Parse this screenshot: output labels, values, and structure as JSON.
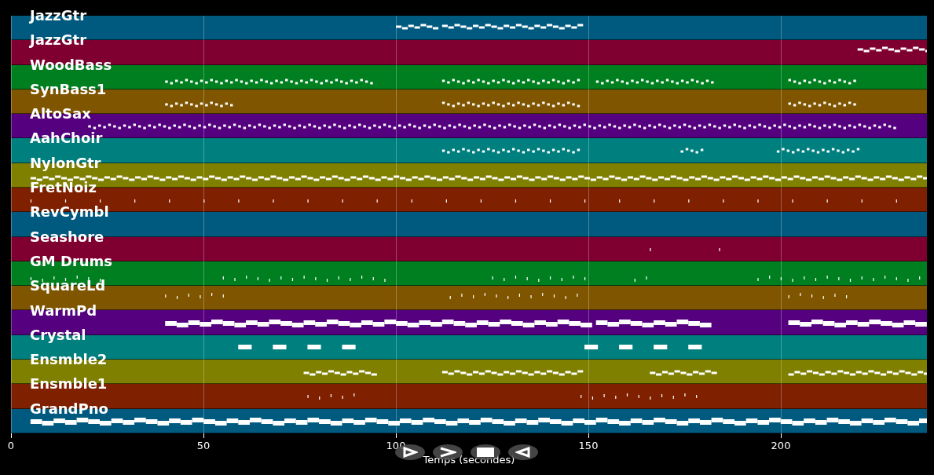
{
  "tracks": [
    {
      "name": "JazzGtr",
      "color": "#005a7f"
    },
    {
      "name": "JazzGtr",
      "color": "#7f0030"
    },
    {
      "name": "WoodBass",
      "color": "#007f20"
    },
    {
      "name": "SynBass1",
      "color": "#7f5500"
    },
    {
      "name": "AltoSax",
      "color": "#55007f"
    },
    {
      "name": "AahChoir",
      "color": "#007f7f"
    },
    {
      "name": "NylonGtr",
      "color": "#7f7f00"
    },
    {
      "name": "FretNoiz",
      "color": "#7f2000"
    },
    {
      "name": "RevCymbl",
      "color": "#005a7f"
    },
    {
      "name": "Seashore",
      "color": "#7f0030"
    },
    {
      "name": "GM Drums",
      "color": "#007f20"
    },
    {
      "name": "SquareLd",
      "color": "#7f5500"
    },
    {
      "name": "WarmPd",
      "color": "#55007f"
    },
    {
      "name": "Crystal",
      "color": "#007f7f"
    },
    {
      "name": "Ensmble2",
      "color": "#7f7f00"
    },
    {
      "name": "Ensmble1",
      "color": "#7f2000"
    },
    {
      "name": "GrandPno",
      "color": "#005a7f"
    }
  ],
  "x_axis": {
    "ticks": [
      "0",
      "50",
      "100",
      "150",
      "200"
    ],
    "label": "Temps (secondes)"
  },
  "controls": [
    {
      "kind": "play"
    },
    {
      "kind": "forward"
    },
    {
      "kind": "stop"
    },
    {
      "kind": "back"
    }
  ]
}
